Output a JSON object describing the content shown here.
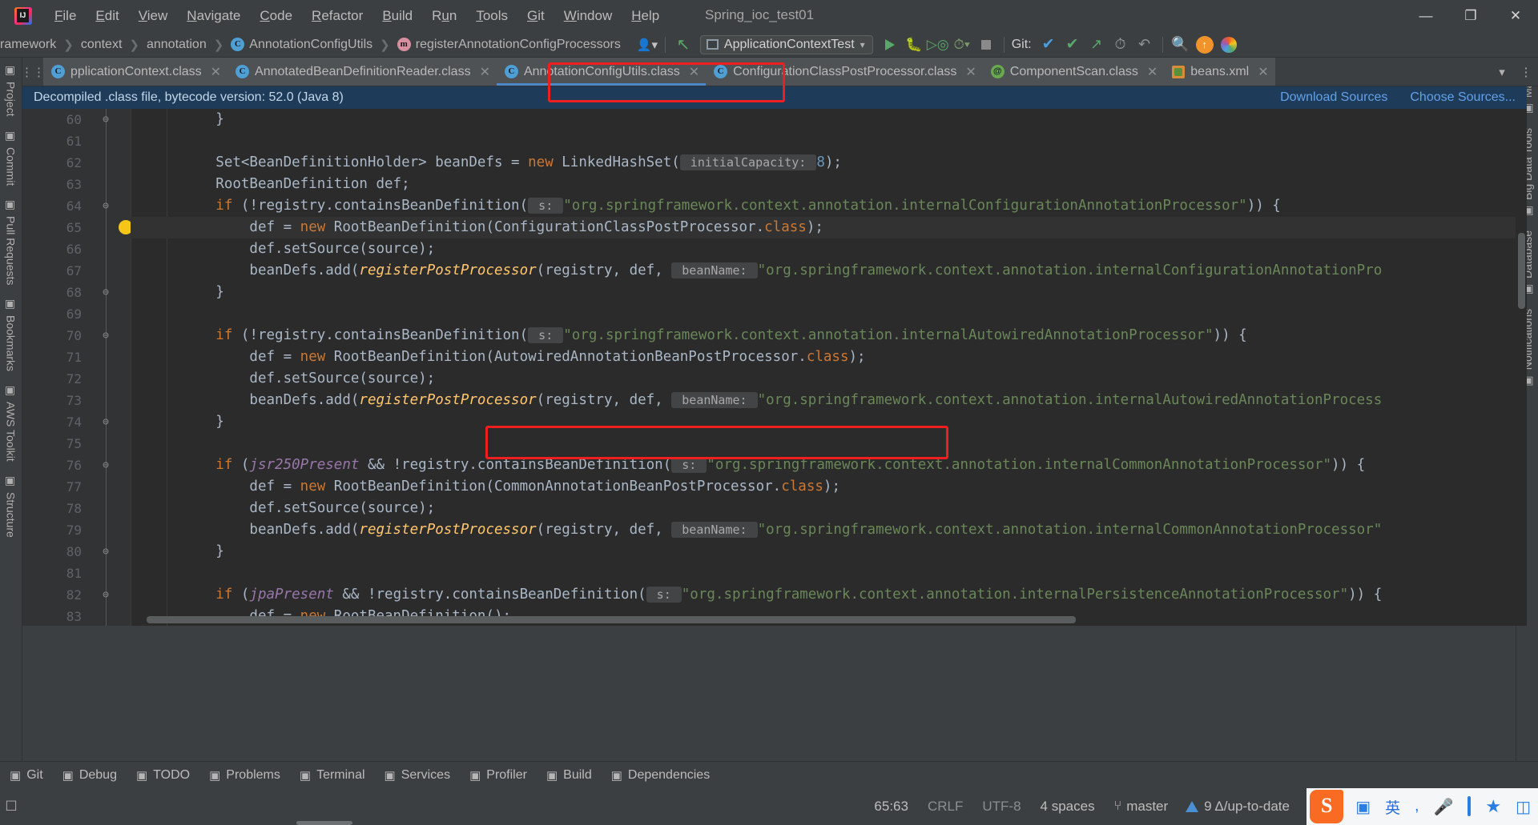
{
  "window": {
    "title": "Spring_ioc_test01",
    "minimize": "—",
    "maximize": "❐",
    "close": "✕"
  },
  "menubar": [
    {
      "label": "File",
      "mnemonic": "F"
    },
    {
      "label": "Edit",
      "mnemonic": "E"
    },
    {
      "label": "View",
      "mnemonic": "V"
    },
    {
      "label": "Navigate",
      "mnemonic": "N"
    },
    {
      "label": "Code",
      "mnemonic": "C"
    },
    {
      "label": "Refactor",
      "mnemonic": "R"
    },
    {
      "label": "Build",
      "mnemonic": "B"
    },
    {
      "label": "Run",
      "mnemonic": "u"
    },
    {
      "label": "Tools",
      "mnemonic": "T"
    },
    {
      "label": "Git",
      "mnemonic": "G"
    },
    {
      "label": "Window",
      "mnemonic": "W"
    },
    {
      "label": "Help",
      "mnemonic": "H"
    }
  ],
  "breadcrumbs": [
    {
      "label": "ramework",
      "icon": "none"
    },
    {
      "label": "context",
      "icon": "none"
    },
    {
      "label": "annotation",
      "icon": "none"
    },
    {
      "label": "AnnotationConfigUtils",
      "icon": "class-badge-icon"
    },
    {
      "label": "registerAnnotationConfigProcessors",
      "icon": "method-badge-icon"
    }
  ],
  "toolbar": {
    "avatar_icon": "user-icon",
    "back_icon": "green-arrow-back-icon",
    "run_config": "ApplicationContextTest",
    "run_icon": "run-icon",
    "debug_icon": "debug-icon",
    "coverage_icon": "run-with-coverage-icon",
    "profile_icon": "profiler-icon",
    "stop_icon": "stop-icon",
    "git_label": "Git:",
    "git_update_icon": "update-project-icon",
    "git_commit_icon": "commit-icon",
    "git_push_icon": "push-icon",
    "git_history_icon": "history-icon",
    "git_rollback_icon": "rollback-icon",
    "search_icon": "search-everywhere-icon",
    "update_icon": "ide-update-icon",
    "plugin_icon": "plugin-icon"
  },
  "left_stripe": [
    {
      "label": "Project",
      "icon": "project-icon"
    },
    {
      "label": "Commit",
      "icon": "commit-icon"
    },
    {
      "label": "Pull Requests",
      "icon": "pull-request-icon"
    },
    {
      "label": "Bookmarks",
      "icon": "bookmark-icon"
    },
    {
      "label": "AWS Toolkit",
      "icon": "aws-icon"
    },
    {
      "label": "Structure",
      "icon": "structure-icon"
    }
  ],
  "right_stripe": [
    {
      "label": "Maven",
      "icon": "maven-icon"
    },
    {
      "label": "Big Data Tools",
      "icon": "bigdata-icon"
    },
    {
      "label": "Database",
      "icon": "database-icon"
    },
    {
      "label": "Notifications",
      "icon": "notifications-icon"
    }
  ],
  "tabs": [
    {
      "label": "pplicationContext.class",
      "icon": "class-icon",
      "active": false
    },
    {
      "label": "AnnotatedBeanDefinitionReader.class",
      "icon": "class-icon",
      "active": false
    },
    {
      "label": "AnnotationConfigUtils.class",
      "icon": "class-icon",
      "active": true,
      "highlighted": true
    },
    {
      "label": "ConfigurationClassPostProcessor.class",
      "icon": "class-icon",
      "active": false
    },
    {
      "label": "ComponentScan.class",
      "icon": "annotation-icon",
      "active": false
    },
    {
      "label": "beans.xml",
      "icon": "xml-icon",
      "active": false
    }
  ],
  "tabs_overflow_icon": "chevron-down-icon",
  "tabs_more_icon": "more-options-icon",
  "notification": {
    "message": "Decompiled .class file, bytecode version: 52.0 (Java 8)",
    "download_sources": "Download Sources",
    "choose_sources": "Choose Sources..."
  },
  "editor": {
    "lines": [
      {
        "n": "60",
        "fold": "⊖",
        "bulb": false,
        "indent": 0,
        "tokens": [
          {
            "t": "        }",
            "c": "ident"
          }
        ]
      },
      {
        "n": "61",
        "fold": "",
        "bulb": false,
        "indent": 0,
        "tokens": []
      },
      {
        "n": "62",
        "fold": "",
        "bulb": false,
        "indent": 0,
        "tokens": [
          {
            "t": "        Set<BeanDefinitionHolder> beanDefs = ",
            "c": "ident"
          },
          {
            "t": "new",
            "c": "kw"
          },
          {
            "t": " LinkedHashSet(",
            "c": "ident"
          },
          {
            "t": " initialCapacity: ",
            "c": "prm"
          },
          {
            "t": "8",
            "c": "num"
          },
          {
            "t": ");",
            "c": "ident"
          }
        ]
      },
      {
        "n": "63",
        "fold": "",
        "bulb": false,
        "indent": 0,
        "tokens": [
          {
            "t": "        RootBeanDefinition def;",
            "c": "ident"
          }
        ]
      },
      {
        "n": "64",
        "fold": "⊖",
        "bulb": false,
        "indent": 0,
        "tokens": [
          {
            "t": "        ",
            "c": "ident"
          },
          {
            "t": "if",
            "c": "kw"
          },
          {
            "t": " (!registry.containsBeanDefinition(",
            "c": "ident"
          },
          {
            "t": " s: ",
            "c": "prm"
          },
          {
            "t": "\"org.springframework.context.annotation.internalConfigurationAnnotationProcessor\"",
            "c": "str"
          },
          {
            "t": ")) {",
            "c": "ident"
          }
        ]
      },
      {
        "n": "65",
        "fold": "",
        "bulb": true,
        "indent": 0,
        "highlight": true,
        "tokens": [
          {
            "t": "            def = ",
            "c": "ident"
          },
          {
            "t": "new",
            "c": "kw"
          },
          {
            "t": " RootBeanDefinition(ConfigurationClassPostProcessor.",
            "c": "ident"
          },
          {
            "t": "class",
            "c": "kw"
          },
          {
            "t": ");",
            "c": "ident"
          }
        ]
      },
      {
        "n": "66",
        "fold": "",
        "bulb": false,
        "indent": 0,
        "tokens": [
          {
            "t": "            def.setSource(source);",
            "c": "ident"
          }
        ]
      },
      {
        "n": "67",
        "fold": "",
        "bulb": false,
        "indent": 0,
        "tokens": [
          {
            "t": "            beanDefs.add(",
            "c": "ident"
          },
          {
            "t": "registerPostProcessor",
            "c": "mth"
          },
          {
            "t": "(registry, def, ",
            "c": "ident"
          },
          {
            "t": " beanName: ",
            "c": "prm"
          },
          {
            "t": "\"org.springframework.context.annotation.internalConfigurationAnnotationPro",
            "c": "str"
          }
        ]
      },
      {
        "n": "68",
        "fold": "⊖",
        "bulb": false,
        "indent": 0,
        "tokens": [
          {
            "t": "        }",
            "c": "ident"
          }
        ]
      },
      {
        "n": "69",
        "fold": "",
        "bulb": false,
        "indent": 0,
        "tokens": []
      },
      {
        "n": "70",
        "fold": "⊖",
        "bulb": false,
        "indent": 0,
        "tokens": [
          {
            "t": "        ",
            "c": "ident"
          },
          {
            "t": "if",
            "c": "kw"
          },
          {
            "t": " (!registry.containsBeanDefinition(",
            "c": "ident"
          },
          {
            "t": " s: ",
            "c": "prm"
          },
          {
            "t": "\"org.springframework.context.annotation.internalAutowiredAnnotationProcessor\"",
            "c": "str"
          },
          {
            "t": ")) {",
            "c": "ident"
          }
        ]
      },
      {
        "n": "71",
        "fold": "",
        "bulb": false,
        "indent": 0,
        "tokens": [
          {
            "t": "            def = ",
            "c": "ident"
          },
          {
            "t": "new",
            "c": "kw"
          },
          {
            "t": " RootBeanDefinition(AutowiredAnnotationBeanPostProcessor.",
            "c": "ident"
          },
          {
            "t": "class",
            "c": "kw"
          },
          {
            "t": ");",
            "c": "ident"
          }
        ]
      },
      {
        "n": "72",
        "fold": "",
        "bulb": false,
        "indent": 0,
        "tokens": [
          {
            "t": "            def.setSource(source);",
            "c": "ident"
          }
        ]
      },
      {
        "n": "73",
        "fold": "",
        "bulb": false,
        "indent": 0,
        "tokens": [
          {
            "t": "            beanDefs.add(",
            "c": "ident"
          },
          {
            "t": "registerPostProcessor",
            "c": "mth"
          },
          {
            "t": "(registry, def, ",
            "c": "ident"
          },
          {
            "t": " beanName: ",
            "c": "prm"
          },
          {
            "t": "\"org.springframework.context.annotation.internalAutowiredAnnotationProcess",
            "c": "str"
          }
        ]
      },
      {
        "n": "74",
        "fold": "⊖",
        "bulb": false,
        "indent": 0,
        "tokens": [
          {
            "t": "        }",
            "c": "ident"
          }
        ]
      },
      {
        "n": "75",
        "fold": "",
        "bulb": false,
        "indent": 0,
        "tokens": []
      },
      {
        "n": "76",
        "fold": "⊖",
        "bulb": false,
        "indent": 0,
        "tokens": [
          {
            "t": "        ",
            "c": "ident"
          },
          {
            "t": "if",
            "c": "kw"
          },
          {
            "t": " (",
            "c": "ident"
          },
          {
            "t": "jsr250Present",
            "c": "ita"
          },
          {
            "t": " && !registry.containsBeanDefinition(",
            "c": "ident"
          },
          {
            "t": " s: ",
            "c": "prm"
          },
          {
            "t": "\"org.springframework.context.annotation.internalCommonAnnotationProcessor\"",
            "c": "str"
          },
          {
            "t": ")) {",
            "c": "ident"
          }
        ]
      },
      {
        "n": "77",
        "fold": "",
        "bulb": false,
        "indent": 0,
        "tokens": [
          {
            "t": "            def = ",
            "c": "ident"
          },
          {
            "t": "new",
            "c": "kw"
          },
          {
            "t": " RootBeanDefinition(CommonAnnotationBeanPostProcessor.",
            "c": "ident"
          },
          {
            "t": "class",
            "c": "kw"
          },
          {
            "t": ");",
            "c": "ident"
          }
        ]
      },
      {
        "n": "78",
        "fold": "",
        "bulb": false,
        "indent": 0,
        "tokens": [
          {
            "t": "            def.setSource(source);",
            "c": "ident"
          }
        ]
      },
      {
        "n": "79",
        "fold": "",
        "bulb": false,
        "indent": 0,
        "tokens": [
          {
            "t": "            beanDefs.add(",
            "c": "ident"
          },
          {
            "t": "registerPostProcessor",
            "c": "mth"
          },
          {
            "t": "(registry, def, ",
            "c": "ident"
          },
          {
            "t": " beanName: ",
            "c": "prm"
          },
          {
            "t": "\"org.springframework.context.annotation.internalCommonAnnotationProcessor\"",
            "c": "str"
          }
        ]
      },
      {
        "n": "80",
        "fold": "⊖",
        "bulb": false,
        "indent": 0,
        "tokens": [
          {
            "t": "        }",
            "c": "ident"
          }
        ]
      },
      {
        "n": "81",
        "fold": "",
        "bulb": false,
        "indent": 0,
        "tokens": []
      },
      {
        "n": "82",
        "fold": "⊖",
        "bulb": false,
        "indent": 0,
        "tokens": [
          {
            "t": "        ",
            "c": "ident"
          },
          {
            "t": "if",
            "c": "kw"
          },
          {
            "t": " (",
            "c": "ident"
          },
          {
            "t": "jpaPresent",
            "c": "ita"
          },
          {
            "t": " && !registry.containsBeanDefinition(",
            "c": "ident"
          },
          {
            "t": " s: ",
            "c": "prm"
          },
          {
            "t": "\"org.springframework.context.annotation.internalPersistenceAnnotationProcessor\"",
            "c": "str"
          },
          {
            "t": ")) {",
            "c": "ident"
          }
        ]
      },
      {
        "n": "83",
        "fold": "",
        "bulb": false,
        "indent": 0,
        "tokens": [
          {
            "t": "            def = ",
            "c": "ident"
          },
          {
            "t": "new",
            "c": "kw"
          },
          {
            "t": " RootBeanDefinition();",
            "c": "ident"
          }
        ]
      }
    ]
  },
  "annotations": {
    "tab_highlight": "red-box-around-active-tab",
    "code_highlight": "red-box-around-line-71"
  },
  "bottom_tools": [
    {
      "label": "Git",
      "icon": "git-branch-icon"
    },
    {
      "label": "Debug",
      "icon": "debug-icon"
    },
    {
      "label": "TODO",
      "icon": "todo-icon"
    },
    {
      "label": "Problems",
      "icon": "problems-icon"
    },
    {
      "label": "Terminal",
      "icon": "terminal-icon"
    },
    {
      "label": "Services",
      "icon": "services-icon"
    },
    {
      "label": "Profiler",
      "icon": "profiler-icon"
    },
    {
      "label": "Build",
      "icon": "build-hammer-icon"
    },
    {
      "label": "Dependencies",
      "icon": "dependencies-icon"
    }
  ],
  "statusbar": {
    "caret": "65:63",
    "line_sep": "CRLF",
    "encoding": "UTF-8",
    "indent": "4 spaces",
    "branch": "master",
    "branch_icon": "git-branch-icon",
    "update_text": "9 Δ/up-to-date",
    "update_icon": "update-triangle-icon",
    "toggle_icon": "toggle-sidebar-icon"
  },
  "ime": {
    "logo": "S",
    "lang": "英",
    "comma": ",",
    "mic_icon": "microphone-icon",
    "keyboard_icon": "keyboard-icon",
    "bowtie_icon": "bowtie-icon",
    "box_icon": "tools-icon",
    "grid_icon": "grid-icon"
  }
}
